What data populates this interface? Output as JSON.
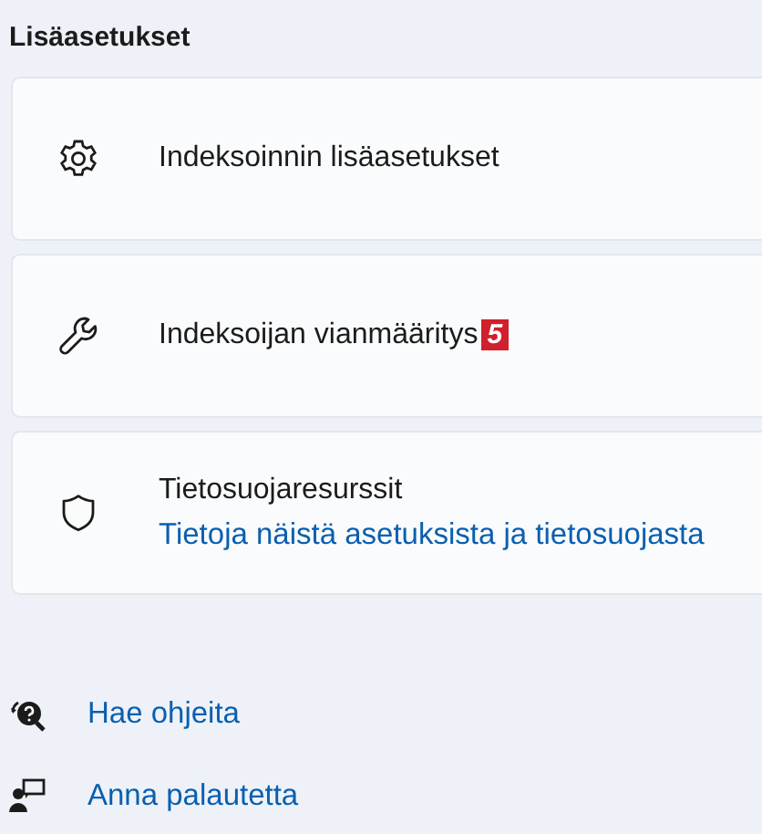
{
  "section_title": "Lisäasetukset",
  "cards": [
    {
      "kind": "settings",
      "title": "Indeksoinnin lisäasetukset"
    },
    {
      "kind": "tool",
      "title": "Indeksoijan vianmääritys",
      "badge": "5"
    },
    {
      "kind": "privacy",
      "title": "Tietosuojaresurssit",
      "link": "Tietoja näistä asetuksista ja tietosuojasta"
    }
  ],
  "help_links": [
    {
      "kind": "help",
      "label": "Hae ohjeita"
    },
    {
      "kind": "feedback",
      "label": "Anna palautetta"
    }
  ]
}
